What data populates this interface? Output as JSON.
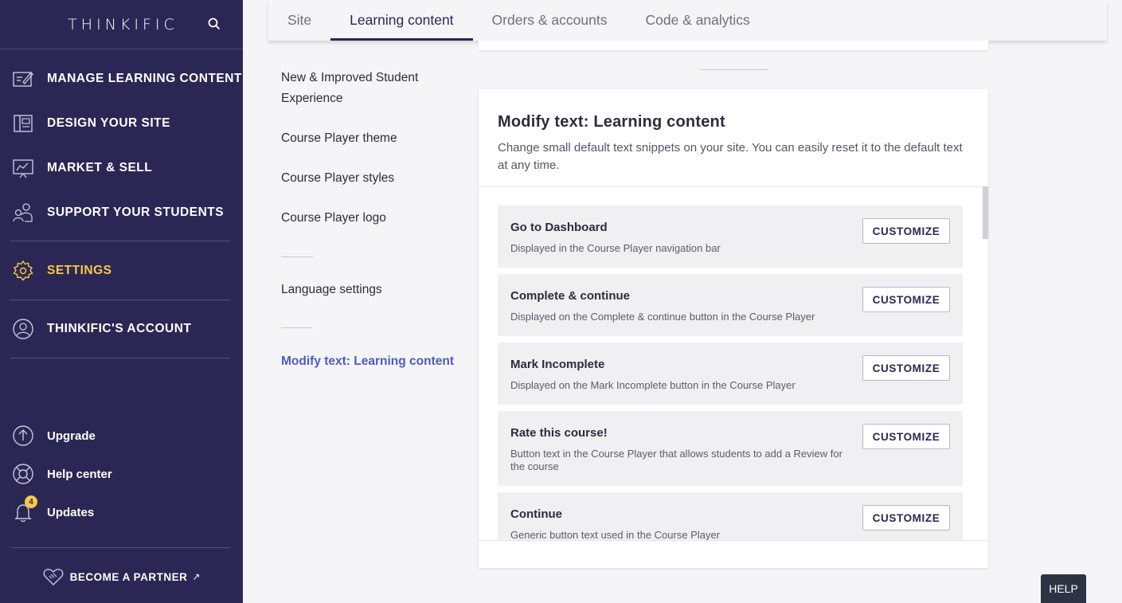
{
  "sidebar": {
    "brand": "THINKIFIC",
    "nav": [
      {
        "label": "MANAGE LEARNING CONTENT",
        "icon": "manage-content-icon"
      },
      {
        "label": "DESIGN YOUR SITE",
        "icon": "design-layout-icon"
      },
      {
        "label": "MARKET & SELL",
        "icon": "market-chart-icon"
      },
      {
        "label": "SUPPORT YOUR STUDENTS",
        "icon": "students-icon"
      },
      {
        "label": "SETTINGS",
        "icon": "gear-icon",
        "active": true
      },
      {
        "label": "THINKIFIC'S ACCOUNT",
        "icon": "account-icon"
      }
    ],
    "bottom": [
      {
        "label": "Upgrade",
        "icon": "upgrade-icon"
      },
      {
        "label": "Help center",
        "icon": "lifebuoy-icon"
      },
      {
        "label": "Updates",
        "icon": "bell-icon",
        "badge": "4"
      }
    ],
    "partner": "BECOME A PARTNER"
  },
  "tabs": [
    {
      "label": "Site"
    },
    {
      "label": "Learning content",
      "active": true
    },
    {
      "label": "Orders & accounts"
    },
    {
      "label": "Code & analytics"
    }
  ],
  "subnav": {
    "items": [
      "New & Improved Student Experience",
      "Course Player theme",
      "Course Player styles",
      "Course Player logo"
    ],
    "language": "Language settings",
    "modify": "Modify text: Learning content"
  },
  "card": {
    "title": "Modify text: Learning content",
    "description": "Change small default text snippets on your site. You can easily reset it to the default text at any time.",
    "rows": [
      {
        "title": "Go to Dashboard",
        "desc": "Displayed in the Course Player navigation bar",
        "button": "CUSTOMIZE"
      },
      {
        "title": "Complete & continue",
        "desc": "Displayed on the Complete & continue button in the Course Player",
        "button": "CUSTOMIZE"
      },
      {
        "title": "Mark Incomplete",
        "desc": "Displayed on the Mark Incomplete button in the Course Player",
        "button": "CUSTOMIZE"
      },
      {
        "title": "Rate this course!",
        "desc": "Button text in the Course Player that allows students to add a Review for the course",
        "button": "CUSTOMIZE"
      },
      {
        "title": "Continue",
        "desc": "Generic button text used in the Course Player",
        "button": "CUSTOMIZE"
      }
    ]
  },
  "help": "HELP",
  "colors": {
    "sidebar": "#2b2755",
    "accent": "#f9c84a",
    "link": "#4e5bc4"
  }
}
